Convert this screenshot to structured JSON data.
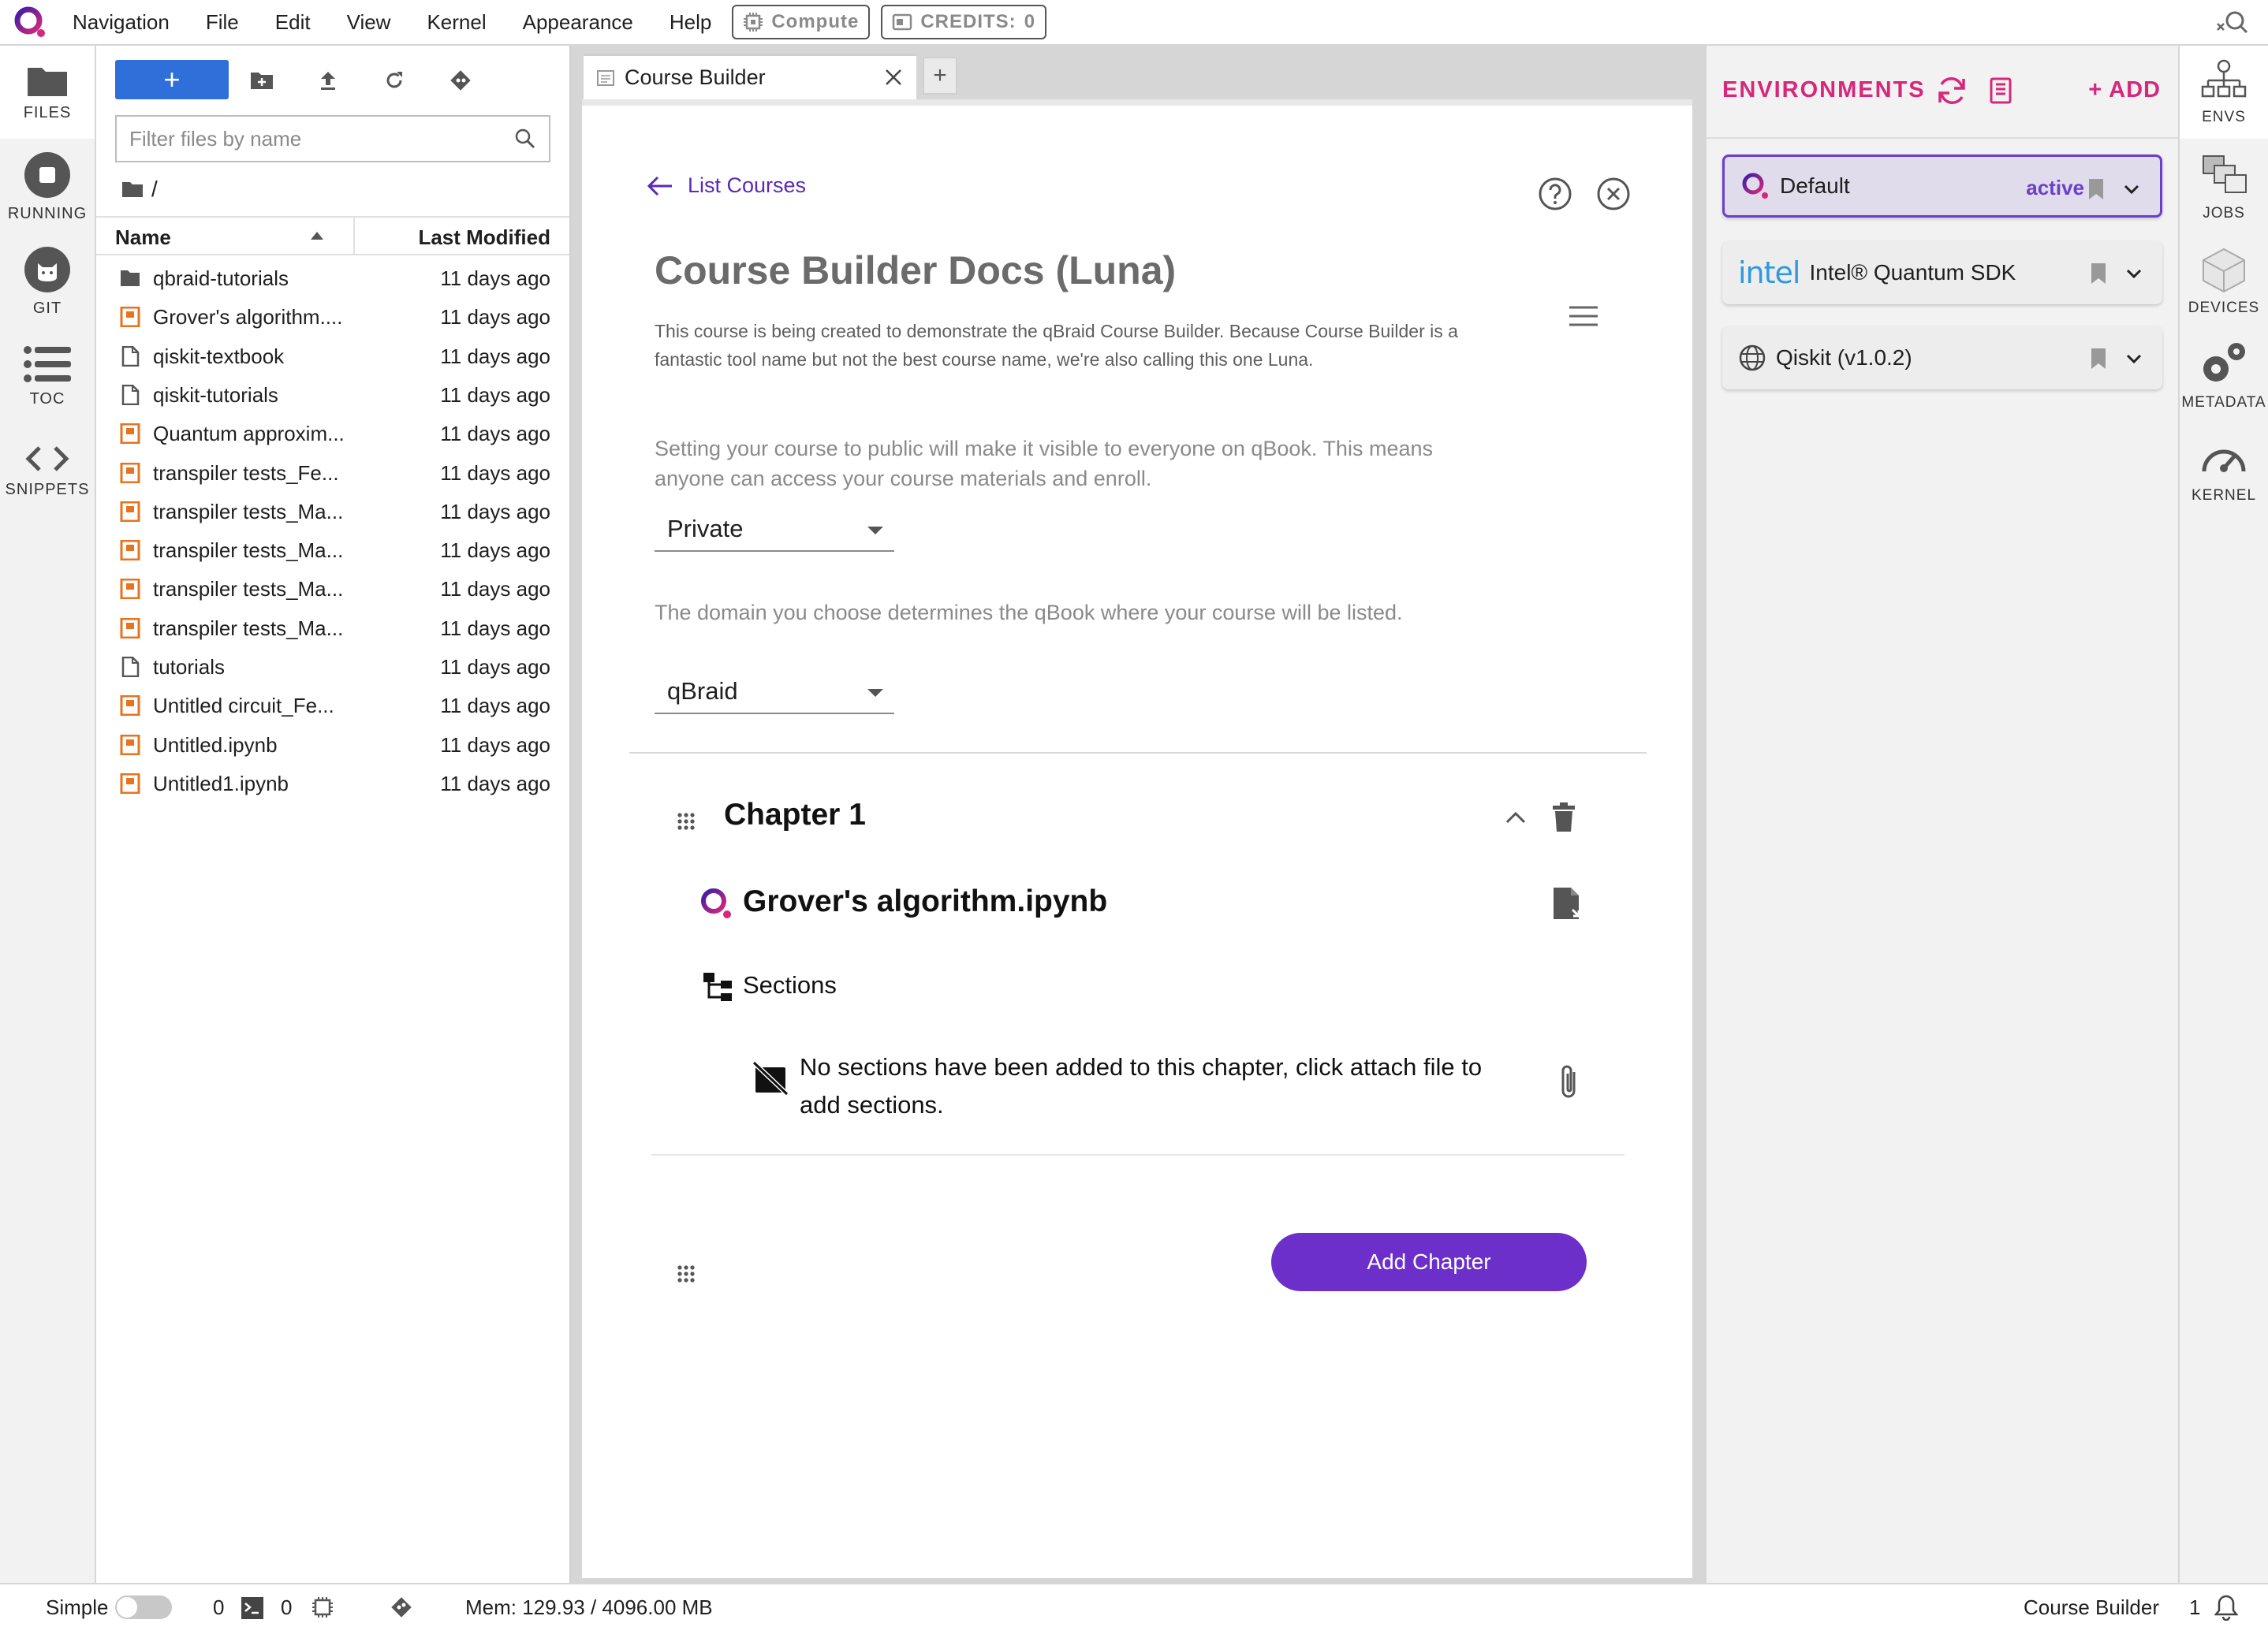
{
  "menubar": {
    "items": [
      "Navigation",
      "File",
      "Edit",
      "View",
      "Kernel",
      "Appearance",
      "Help"
    ],
    "compute_label": "Compute",
    "credits_label": "CREDITS:",
    "credits_value": "0"
  },
  "left_activity": {
    "tabs": [
      {
        "label": "FILES",
        "icon": "folder-icon"
      },
      {
        "label": "RUNNING",
        "icon": "stop-circle-icon"
      },
      {
        "label": "GIT",
        "icon": "github-icon"
      },
      {
        "label": "TOC",
        "icon": "list-icon"
      },
      {
        "label": "SNIPPETS",
        "icon": "code-icon"
      }
    ]
  },
  "file_browser": {
    "new_label": "+",
    "filter_placeholder": "Filter files by name",
    "path": "/",
    "columns": {
      "name": "Name",
      "modified": "Last Modified"
    },
    "files": [
      {
        "name": "qbraid-tutorials",
        "type": "folder",
        "modified": "11 days ago"
      },
      {
        "name": "Grover's algorithm....",
        "type": "notebook",
        "modified": "11 days ago"
      },
      {
        "name": "qiskit-textbook",
        "type": "file",
        "modified": "11 days ago"
      },
      {
        "name": "qiskit-tutorials",
        "type": "file",
        "modified": "11 days ago"
      },
      {
        "name": "Quantum approxim...",
        "type": "notebook",
        "modified": "11 days ago"
      },
      {
        "name": "transpiler tests_Fe...",
        "type": "notebook",
        "modified": "11 days ago"
      },
      {
        "name": "transpiler tests_Ma...",
        "type": "notebook",
        "modified": "11 days ago"
      },
      {
        "name": "transpiler tests_Ma...",
        "type": "notebook",
        "modified": "11 days ago"
      },
      {
        "name": "transpiler tests_Ma...",
        "type": "notebook",
        "modified": "11 days ago"
      },
      {
        "name": "transpiler tests_Ma...",
        "type": "notebook",
        "modified": "11 days ago"
      },
      {
        "name": "tutorials",
        "type": "file",
        "modified": "11 days ago"
      },
      {
        "name": "Untitled circuit_Fe...",
        "type": "notebook",
        "modified": "11 days ago"
      },
      {
        "name": "Untitled.ipynb",
        "type": "notebook",
        "modified": "11 days ago"
      },
      {
        "name": "Untitled1.ipynb",
        "type": "notebook",
        "modified": "11 days ago"
      }
    ]
  },
  "tab": {
    "label": "Course Builder",
    "add_label": "+"
  },
  "course": {
    "back_label": "List Courses",
    "title": "Course Builder Docs (Luna)",
    "description": "This course is being created to demonstrate the qBraid Course Builder. Because Course Builder is a fantastic tool name but not the best course name, we're also calling this one Luna.",
    "visibility_hint": "Setting your course to public will make it visible to everyone on qBook. This means anyone can access your course materials and enroll.",
    "visibility_value": "Private",
    "domain_hint": "The domain you choose determines the qBook where your course will be listed.",
    "domain_value": "qBraid",
    "chapter": {
      "title": "Chapter 1",
      "notebook": "Grover's algorithm.ipynb",
      "sections_label": "Sections",
      "empty_message": "No sections have been added to this chapter, click attach file to add sections."
    },
    "add_chapter_label": "Add Chapter"
  },
  "environments": {
    "title": "ENVIRONMENTS",
    "add_label": "+ ADD",
    "items": [
      {
        "name": "Default",
        "status": "active",
        "logo": "qbraid-logo"
      },
      {
        "name": "Intel® Quantum SDK",
        "status": "",
        "logo_text": "intel"
      },
      {
        "name": "Qiskit (v1.0.2)",
        "status": "",
        "logo": "globe-icon"
      }
    ]
  },
  "right_activity": {
    "tabs": [
      {
        "label": "ENVS",
        "icon": "envs-icon"
      },
      {
        "label": "JOBS",
        "icon": "jobs-icon"
      },
      {
        "label": "DEVICES",
        "icon": "devices-icon"
      },
      {
        "label": "METADATA",
        "icon": "gears-icon"
      },
      {
        "label": "KERNEL",
        "icon": "gauge-icon"
      }
    ]
  },
  "statusbar": {
    "mode_label": "Simple",
    "kernels_count": "0",
    "terminals_count": "0",
    "memory": "Mem: 129.93 / 4096.00 MB",
    "active_doc": "Course Builder",
    "notifications": "1"
  },
  "colors": {
    "accent_purple": "#6d2fc9",
    "env_pink": "#d6287b",
    "primary_blue": "#2e6fd9",
    "notebook_orange": "#e8731f"
  }
}
